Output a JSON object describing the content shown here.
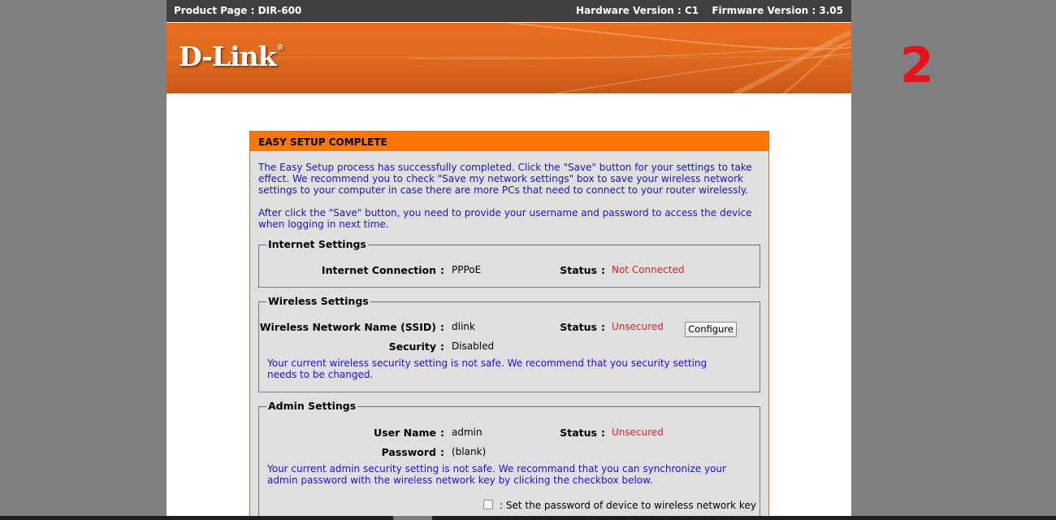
{
  "topbar": {
    "product": "Product Page : DIR-600",
    "hardware": "Hardware Version : C1",
    "firmware": "Firmware Version : 3.05"
  },
  "banner": {
    "logo_text": "D-Link",
    "logo_mark": "®"
  },
  "step_number": "2",
  "panel": {
    "title": "EASY SETUP COMPLETE",
    "intro_1": "The Easy Setup process has successfully completed. Click the \"Save\" button for your settings to take effect. We recommend you to check \"Save my network settings\" box to save your wireless network settings to your computer in case there are more PCs that need to connect to your router wirelessly.",
    "intro_2": "After click the \"Save\" button, you need to provide your username and password to access the device when logging in next time."
  },
  "internet": {
    "legend": "Internet Settings",
    "connection_label": "Internet Connection",
    "connection_value": "PPPoE",
    "status_label": "Status",
    "status_value": "Not Connected"
  },
  "wireless": {
    "legend": "Wireless Settings",
    "ssid_label": "Wireless Network Name (SSID)",
    "ssid_value": "dlink",
    "status_label": "Status",
    "status_value": "Unsecured",
    "configure_button": "Configure",
    "security_label": "Security",
    "security_value": "Disabled",
    "note": "Your current wireless security setting is not safe. We recommend that you security setting needs to be changed."
  },
  "admin": {
    "legend": "Admin Settings",
    "username_label": "User Name",
    "username_value": "admin",
    "status_label": "Status",
    "status_value": "Unsecured",
    "password_label": "Password",
    "password_value": "(blank)",
    "note": "Your current admin security setting is not safe. We recommand that you can synchronize your admin password with the wireless network key by clicking the checkbox below.",
    "checkbox_label": ": Set the password of device to wireless network key"
  },
  "separator": ":",
  "colors": {
    "header_bar": "#404040",
    "banner_orange": "#e06a1d",
    "panel_title_bg": "#ff7700",
    "link_blue": "#1a14c8",
    "status_red": "#ea1b24",
    "step_red": "#e8121c"
  }
}
